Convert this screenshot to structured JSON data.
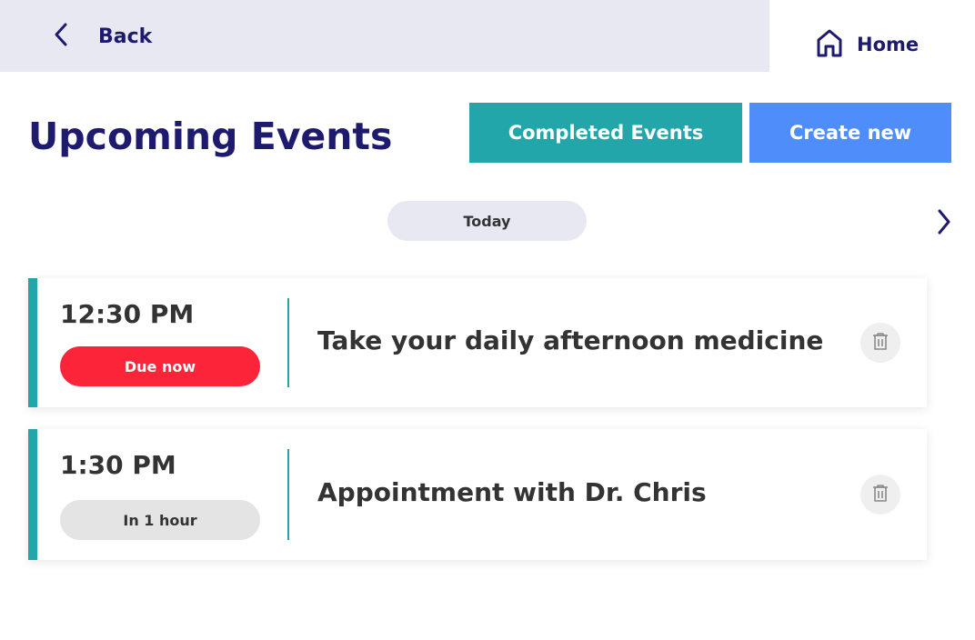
{
  "nav": {
    "back_label": "Back",
    "home_label": "Home"
  },
  "header": {
    "title": "Upcoming Events",
    "completed_button": "Completed Events",
    "create_button": "Create new"
  },
  "date_selector": {
    "current": "Today"
  },
  "events": [
    {
      "time": "12:30 PM",
      "status": "Due now",
      "title": "Take your daily afternoon medicine"
    },
    {
      "time": "1:30 PM",
      "status": "In 1 hour",
      "title": "Appointment with Dr. Chris"
    }
  ],
  "icons": {
    "back": "chevron-left-icon",
    "home": "home-icon",
    "next": "chevron-right-icon",
    "delete": "trash-icon"
  },
  "colors": {
    "primary_text": "#1e1a6e",
    "teal": "#23a6aa",
    "blue": "#4e8dfa",
    "due_red": "#fc2438",
    "topbar_bg": "#e8e8f3"
  }
}
